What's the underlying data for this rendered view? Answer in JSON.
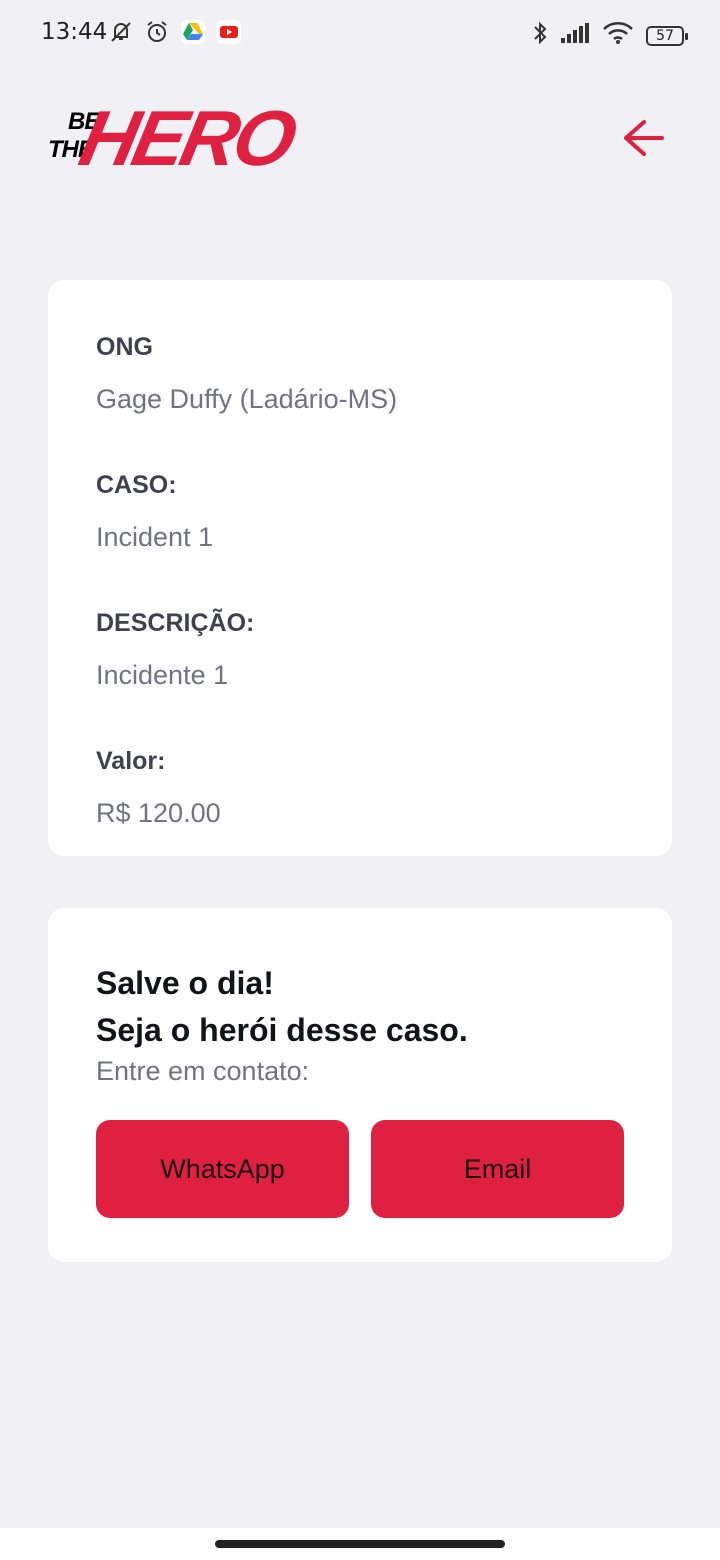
{
  "status_bar": {
    "time": "13:44",
    "battery": "57",
    "left_icons": [
      "muted-bell-icon",
      "alarm-icon",
      "google-drive-icon",
      "youtube-icon"
    ],
    "right_icons": [
      "bluetooth-icon",
      "signal-icon",
      "wifi-icon",
      "battery-icon"
    ]
  },
  "header": {
    "logo": {
      "be": "BE",
      "the": "THE",
      "hero": "HERO"
    },
    "back_icon": "arrow-left-icon"
  },
  "incident": {
    "ong_label": "ONG",
    "ong_value": "Gage Duffy (Ladário-MS)",
    "case_label": "CASO:",
    "case_value": "Incident 1",
    "description_label": "DESCRIÇÃO:",
    "description_value": "Incidente 1",
    "value_label": "Valor:",
    "value_value": "R$ 120.00"
  },
  "contact": {
    "title_line1": "Salve o dia!",
    "title_line2": "Seja o herói desse caso.",
    "subtitle": "Entre em contato:",
    "whatsapp_label": "WhatsApp",
    "email_label": "Email"
  },
  "colors": {
    "accent": "#e02041",
    "background": "#f0f0f5",
    "card": "#ffffff",
    "label": "#41414d",
    "value": "#737380"
  }
}
